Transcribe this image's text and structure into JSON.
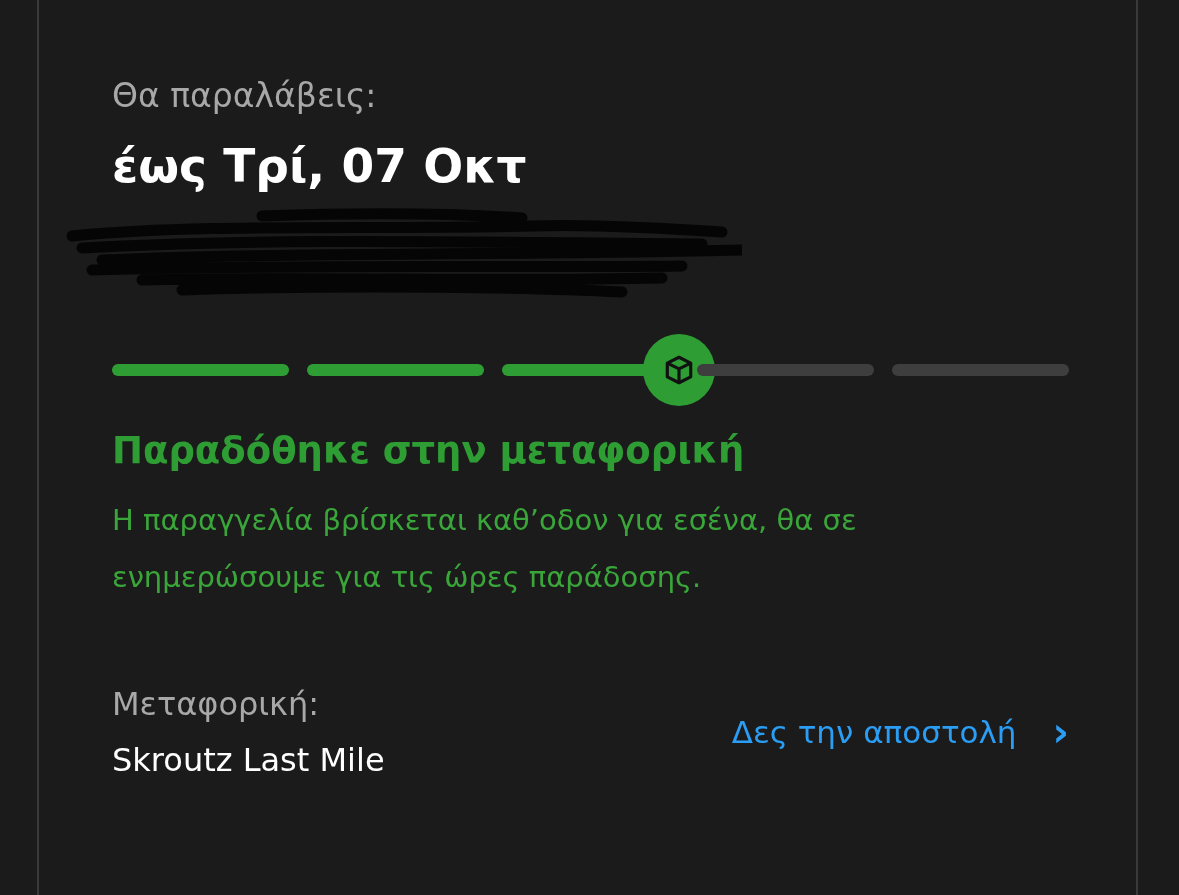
{
  "delivery": {
    "label": "Θα παραλάβεις:",
    "date": "έως Τρί, 07 Οκτ"
  },
  "progress": {
    "steps": [
      {
        "done": true,
        "current": false
      },
      {
        "done": true,
        "current": false
      },
      {
        "done": true,
        "current": true
      },
      {
        "done": false,
        "current": false
      },
      {
        "done": false,
        "current": false
      }
    ]
  },
  "status": {
    "title": "Παραδόθηκε στην μεταφορική",
    "description": "Η παραγγελία βρίσκεται καθ’οδον για εσένα, θα σε ενημερώσουμε για τις ώρες παράδοσης."
  },
  "carrier": {
    "label": "Μεταφορική:",
    "name": "Skroutz Last Mile",
    "link": "Δες την αποστολή",
    "chevron": "›"
  }
}
